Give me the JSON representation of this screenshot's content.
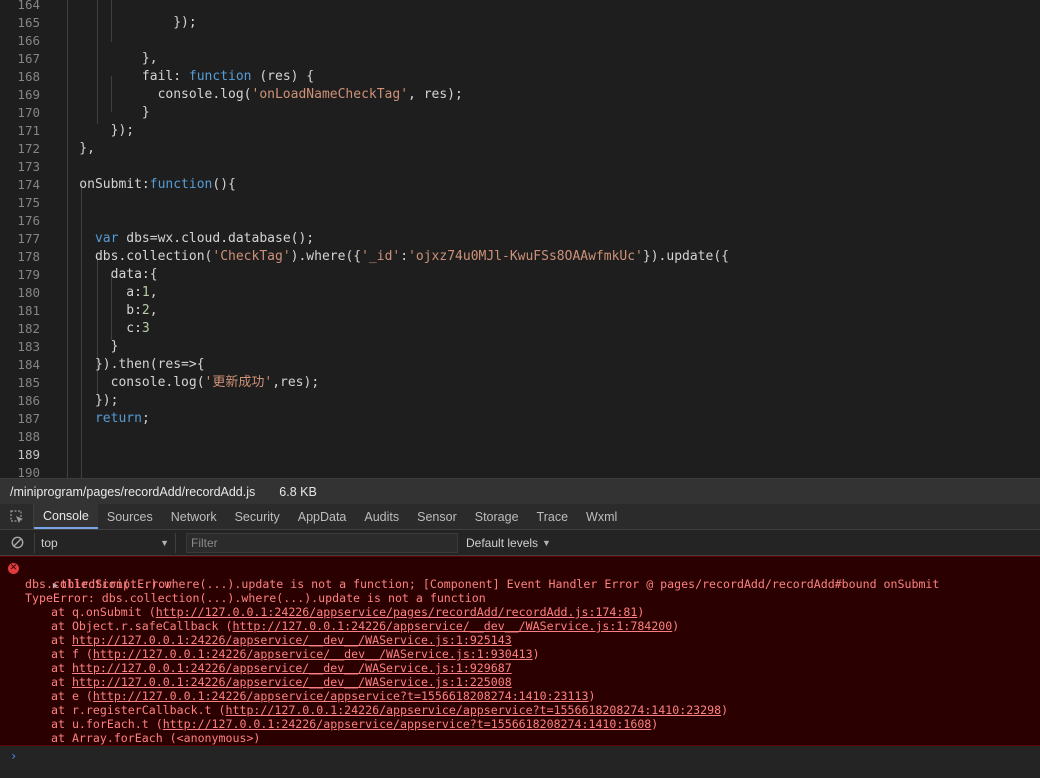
{
  "editor": {
    "lines": [
      {
        "n": "164",
        "segs": [
          {
            "t": "",
            "c": "plain"
          }
        ]
      },
      {
        "n": "165",
        "segs": [
          {
            "t": "                });",
            "c": "plain"
          }
        ]
      },
      {
        "n": "166",
        "segs": [
          {
            "t": "",
            "c": "plain"
          }
        ]
      },
      {
        "n": "167",
        "segs": [
          {
            "t": "            },",
            "c": "plain"
          }
        ]
      },
      {
        "n": "168",
        "segs": [
          {
            "t": "            fail: ",
            "c": "plain"
          },
          {
            "t": "function",
            "c": "kw"
          },
          {
            "t": " (res) {",
            "c": "plain"
          }
        ]
      },
      {
        "n": "169",
        "segs": [
          {
            "t": "              console.log(",
            "c": "plain"
          },
          {
            "t": "'onLoadNameCheckTag'",
            "c": "str"
          },
          {
            "t": ", res);",
            "c": "plain"
          }
        ]
      },
      {
        "n": "170",
        "segs": [
          {
            "t": "            }",
            "c": "plain"
          }
        ]
      },
      {
        "n": "171",
        "segs": [
          {
            "t": "        });",
            "c": "plain"
          }
        ]
      },
      {
        "n": "172",
        "segs": [
          {
            "t": "    },",
            "c": "plain"
          }
        ]
      },
      {
        "n": "173",
        "segs": [
          {
            "t": "",
            "c": "plain"
          }
        ]
      },
      {
        "n": "174",
        "segs": [
          {
            "t": "    onSubmit:",
            "c": "plain"
          },
          {
            "t": "function",
            "c": "kw"
          },
          {
            "t": "(){",
            "c": "plain"
          }
        ]
      },
      {
        "n": "175",
        "segs": [
          {
            "t": "",
            "c": "plain"
          }
        ]
      },
      {
        "n": "176",
        "segs": [
          {
            "t": "",
            "c": "plain"
          }
        ]
      },
      {
        "n": "177",
        "segs": [
          {
            "t": "      ",
            "c": "plain"
          },
          {
            "t": "var",
            "c": "kw"
          },
          {
            "t": " dbs=wx.cloud.database();",
            "c": "plain"
          }
        ]
      },
      {
        "n": "178",
        "segs": [
          {
            "t": "      dbs.collection(",
            "c": "plain"
          },
          {
            "t": "'CheckTag'",
            "c": "str"
          },
          {
            "t": ").where({",
            "c": "plain"
          },
          {
            "t": "'_id'",
            "c": "str"
          },
          {
            "t": ":",
            "c": "plain"
          },
          {
            "t": "'ojxz74u0MJl-KwuFSs8OAAwfmkUc'",
            "c": "str"
          },
          {
            "t": "}).update({",
            "c": "plain"
          }
        ]
      },
      {
        "n": "179",
        "segs": [
          {
            "t": "        data:{",
            "c": "plain"
          }
        ]
      },
      {
        "n": "180",
        "segs": [
          {
            "t": "          a:",
            "c": "plain"
          },
          {
            "t": "1",
            "c": "num"
          },
          {
            "t": ",",
            "c": "plain"
          }
        ]
      },
      {
        "n": "181",
        "segs": [
          {
            "t": "          b:",
            "c": "plain"
          },
          {
            "t": "2",
            "c": "num"
          },
          {
            "t": ",",
            "c": "plain"
          }
        ]
      },
      {
        "n": "182",
        "segs": [
          {
            "t": "          c:",
            "c": "plain"
          },
          {
            "t": "3",
            "c": "num"
          }
        ]
      },
      {
        "n": "183",
        "segs": [
          {
            "t": "        }",
            "c": "plain"
          }
        ]
      },
      {
        "n": "184",
        "segs": [
          {
            "t": "      }).then(res=>{",
            "c": "plain"
          }
        ]
      },
      {
        "n": "185",
        "segs": [
          {
            "t": "        console.log(",
            "c": "plain"
          },
          {
            "t": "'更新成功'",
            "c": "str"
          },
          {
            "t": ",res);",
            "c": "plain"
          }
        ]
      },
      {
        "n": "186",
        "segs": [
          {
            "t": "      });",
            "c": "plain"
          }
        ]
      },
      {
        "n": "187",
        "segs": [
          {
            "t": "      ",
            "c": "plain"
          },
          {
            "t": "return",
            "c": "kw"
          },
          {
            "t": ";",
            "c": "plain"
          }
        ]
      },
      {
        "n": "188",
        "segs": [
          {
            "t": "",
            "c": "plain"
          }
        ]
      },
      {
        "n": "189",
        "segs": [
          {
            "t": "",
            "c": "plain"
          }
        ],
        "active": true
      },
      {
        "n": "190",
        "segs": [
          {
            "t": "",
            "c": "plain"
          }
        ]
      }
    ]
  },
  "filebar": {
    "path": "/miniprogram/pages/recordAdd/recordAdd.js",
    "size": "6.8 KB"
  },
  "devtools": {
    "tabs": [
      "Console",
      "Sources",
      "Network",
      "Security",
      "AppData",
      "Audits",
      "Sensor",
      "Storage",
      "Trace",
      "Wxml"
    ],
    "active_tab": "Console"
  },
  "toolbar": {
    "context": "top",
    "filter_placeholder": "Filter",
    "levels_label": "Default levels"
  },
  "console": {
    "error_title": "thirdScriptError",
    "lines": [
      {
        "indent": 0,
        "pre": "dbs.collection(...).where(...).update is not a function; [Component] Event Handler Error @ pages/recordAdd/recordAdd#bound onSubmit",
        "link": "",
        "post": ""
      },
      {
        "indent": 0,
        "pre": "TypeError: dbs.collection(...).where(...).update is not a function",
        "link": "",
        "post": ""
      },
      {
        "indent": 1,
        "pre": "at q.onSubmit (",
        "link": "http://127.0.0.1:24226/appservice/pages/recordAdd/recordAdd.js:174:81",
        "post": ")"
      },
      {
        "indent": 1,
        "pre": "at Object.r.safeCallback (",
        "link": "http://127.0.0.1:24226/appservice/__dev__/WAService.js:1:784200",
        "post": ")"
      },
      {
        "indent": 1,
        "pre": "at ",
        "link": "http://127.0.0.1:24226/appservice/__dev__/WAService.js:1:925143",
        "post": ""
      },
      {
        "indent": 1,
        "pre": "at f (",
        "link": "http://127.0.0.1:24226/appservice/__dev__/WAService.js:1:930413",
        "post": ")"
      },
      {
        "indent": 1,
        "pre": "at ",
        "link": "http://127.0.0.1:24226/appservice/__dev__/WAService.js:1:929687",
        "post": ""
      },
      {
        "indent": 1,
        "pre": "at ",
        "link": "http://127.0.0.1:24226/appservice/__dev__/WAService.js:1:225008",
        "post": ""
      },
      {
        "indent": 1,
        "pre": "at e (",
        "link": "http://127.0.0.1:24226/appservice/appservice?t=1556618208274:1410:23113",
        "post": ")"
      },
      {
        "indent": 1,
        "pre": "at r.registerCallback.t (",
        "link": "http://127.0.0.1:24226/appservice/appservice?t=1556618208274:1410:23298",
        "post": ")"
      },
      {
        "indent": 1,
        "pre": "at u.forEach.t (",
        "link": "http://127.0.0.1:24226/appservice/appservice?t=1556618208274:1410:1608",
        "post": ")"
      },
      {
        "indent": 1,
        "pre": "at Array.forEach (<anonymous>)",
        "link": "",
        "post": ""
      }
    ]
  },
  "icons": {
    "inspect": "inspect-element-icon",
    "clear": "clear-console-icon",
    "error": "error-icon",
    "prompt": "prompt-caret-icon"
  },
  "colors": {
    "error_text": "#ff8080",
    "error_bg": "#2b0000",
    "keyword": "#569cd6",
    "string": "#ce9178",
    "number": "#b5cea8",
    "active_tab_underline": "#7aa4e8"
  }
}
